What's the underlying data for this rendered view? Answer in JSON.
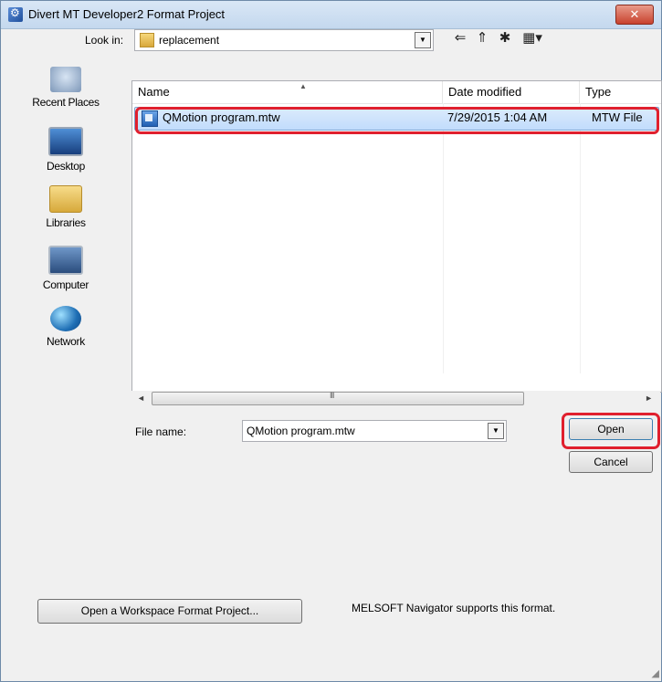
{
  "window": {
    "title": "Divert MT Developer2 Format Project",
    "close_label": "✕"
  },
  "lookin": {
    "label": "Look in:",
    "value": "replacement"
  },
  "toolbar": {
    "back": "⇐",
    "up": "⇑",
    "newfolder": "✱",
    "view": "▦▾"
  },
  "places": [
    {
      "label": "Recent Places",
      "icon": "recent-places-icon"
    },
    {
      "label": "Desktop",
      "icon": "desktop-icon"
    },
    {
      "label": "Libraries",
      "icon": "libraries-icon"
    },
    {
      "label": "Computer",
      "icon": "computer-icon"
    },
    {
      "label": "Network",
      "icon": "network-icon"
    }
  ],
  "columns": [
    "Name",
    "Date modified",
    "Type"
  ],
  "files": [
    {
      "name": "QMotion program.mtw",
      "date": "7/29/2015 1:04 AM",
      "type": "MTW File"
    }
  ],
  "scroll": {
    "grip": "III"
  },
  "filename": {
    "label": "File name:",
    "value": "QMotion program.mtw"
  },
  "buttons": {
    "open": "Open",
    "cancel": "Cancel",
    "workspace": "Open a Workspace Format Project..."
  },
  "note": "MELSOFT Navigator supports this format.",
  "colors": {
    "highlight": "#e0202e",
    "selection": "#c1dcfc"
  }
}
